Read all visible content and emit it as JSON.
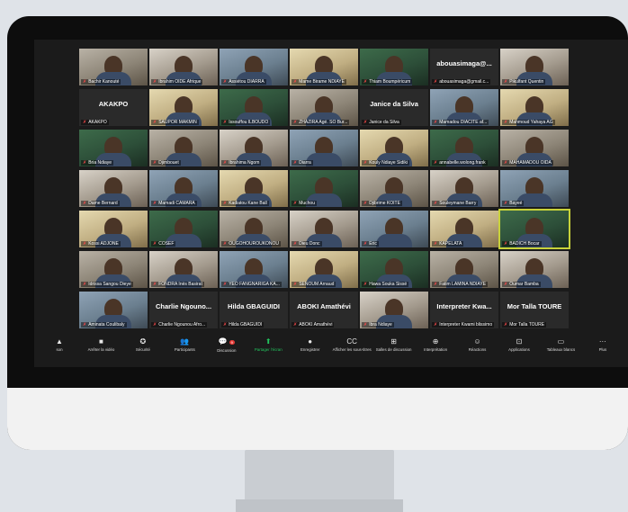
{
  "participants": [
    {
      "name": "Bachir Kanouté",
      "center": ""
    },
    {
      "name": "Ibrahim OIDE Afrique",
      "center": ""
    },
    {
      "name": "Assiétou DIARRA",
      "center": ""
    },
    {
      "name": "Mame Birame NDIAYE",
      "center": ""
    },
    {
      "name": "Thiam Boumpéricum",
      "center": ""
    },
    {
      "name": "abouasimaga@gmail.c...",
      "center": "abouasimaga@..."
    },
    {
      "name": "Pikulfant Quentin",
      "center": ""
    },
    {
      "name": "AKAKPO",
      "center": "AKAKPO"
    },
    {
      "name": "SAUPOR MAKMIN",
      "center": ""
    },
    {
      "name": "Issouffou ILBOUDO",
      "center": ""
    },
    {
      "name": "ZHAZIRA Agé. SO Bur...",
      "center": ""
    },
    {
      "name": "Janice da Silva",
      "center": "Janice da Silva"
    },
    {
      "name": "Mamadou DIACITE af...",
      "center": ""
    },
    {
      "name": "Mahmoud Yahaya AG",
      "center": ""
    },
    {
      "name": "Bria Ndiaye",
      "center": ""
    },
    {
      "name": "Djimbouet",
      "center": ""
    },
    {
      "name": "Ibrahima Ngom",
      "center": ""
    },
    {
      "name": "Diarra",
      "center": ""
    },
    {
      "name": "Kouly Ndiaye Sidiki",
      "center": ""
    },
    {
      "name": "annabelle.wolong.frank",
      "center": ""
    },
    {
      "name": "MAHAMADOU OIDA",
      "center": ""
    },
    {
      "name": "Dame Bernard",
      "center": ""
    },
    {
      "name": "Mamadi CAMARA",
      "center": ""
    },
    {
      "name": "Kadiatou Kane Ball",
      "center": ""
    },
    {
      "name": "Muchou",
      "center": ""
    },
    {
      "name": "Djibrime KOITE",
      "center": ""
    },
    {
      "name": "Souleymane Barry",
      "center": ""
    },
    {
      "name": "Bayeé",
      "center": ""
    },
    {
      "name": "Kossi ADJONE",
      "center": ""
    },
    {
      "name": "COSEF",
      "center": ""
    },
    {
      "name": "OUGOHOUROUKONOU",
      "center": ""
    },
    {
      "name": "Dieu Donc",
      "center": ""
    },
    {
      "name": "Eric",
      "center": ""
    },
    {
      "name": "KAPELATA",
      "center": ""
    },
    {
      "name": "BADICH Bocar",
      "center": ""
    },
    {
      "name": "Idrissa Sangou Dieye",
      "center": ""
    },
    {
      "name": "FONDRA Inès Basirat",
      "center": ""
    },
    {
      "name": "YEO FANGNARIGA KA...",
      "center": ""
    },
    {
      "name": "SENOUM Arnaud",
      "center": ""
    },
    {
      "name": "Hawa Souka Sissé",
      "center": ""
    },
    {
      "name": "Fatim LAMINA NDIAYE",
      "center": ""
    },
    {
      "name": "Oumar Bamba",
      "center": ""
    },
    {
      "name": "Aminata Coulibaly",
      "center": ""
    },
    {
      "name": "Charlie Ngounou Afro...",
      "center": "Charlie Ngouno..."
    },
    {
      "name": "Hilda GBAGUIDI",
      "center": "Hilda GBAGUIDI"
    },
    {
      "name": "ABOKI Amathévi",
      "center": "ABOKI Amathévi"
    },
    {
      "name": "Ibra Ndiaye",
      "center": ""
    },
    {
      "name": "Interpreter Kwami blissimo",
      "center": "Interpreter Kwa..."
    },
    {
      "name": "Mor Talla TOURE",
      "center": "Mor Talla TOURE"
    }
  ],
  "toolbar": [
    {
      "icon": "▲",
      "label": "son",
      "iconName": "audio-menu-icon"
    },
    {
      "icon": "■",
      "label": "Arrêter la vidéo",
      "iconName": "video-icon"
    },
    {
      "icon": "✪",
      "label": "Sécurité",
      "iconName": "security-shield-icon"
    },
    {
      "icon": "👥",
      "label": "Participants",
      "iconName": "participants-icon"
    },
    {
      "icon": "💬",
      "label": "Discussion",
      "iconName": "chat-icon",
      "badge": "9"
    },
    {
      "icon": "⬆",
      "label": "Partager l'écran",
      "iconName": "share-screen-icon",
      "green": true
    },
    {
      "icon": "●",
      "label": "Enregistrer",
      "iconName": "record-icon"
    },
    {
      "icon": "CC",
      "label": "Afficher les sous-titres",
      "iconName": "captions-icon"
    },
    {
      "icon": "⊞",
      "label": "Salles de discussion",
      "iconName": "breakout-rooms-icon"
    },
    {
      "icon": "⊕",
      "label": "Interprétation",
      "iconName": "interpretation-icon"
    },
    {
      "icon": "☺",
      "label": "Réactions",
      "iconName": "reactions-icon"
    },
    {
      "icon": "⊡",
      "label": "Applications",
      "iconName": "apps-icon"
    },
    {
      "icon": "▭",
      "label": "Tableaux blancs",
      "iconName": "whiteboard-icon"
    },
    {
      "icon": "···",
      "label": "Plus",
      "iconName": "more-icon"
    }
  ]
}
